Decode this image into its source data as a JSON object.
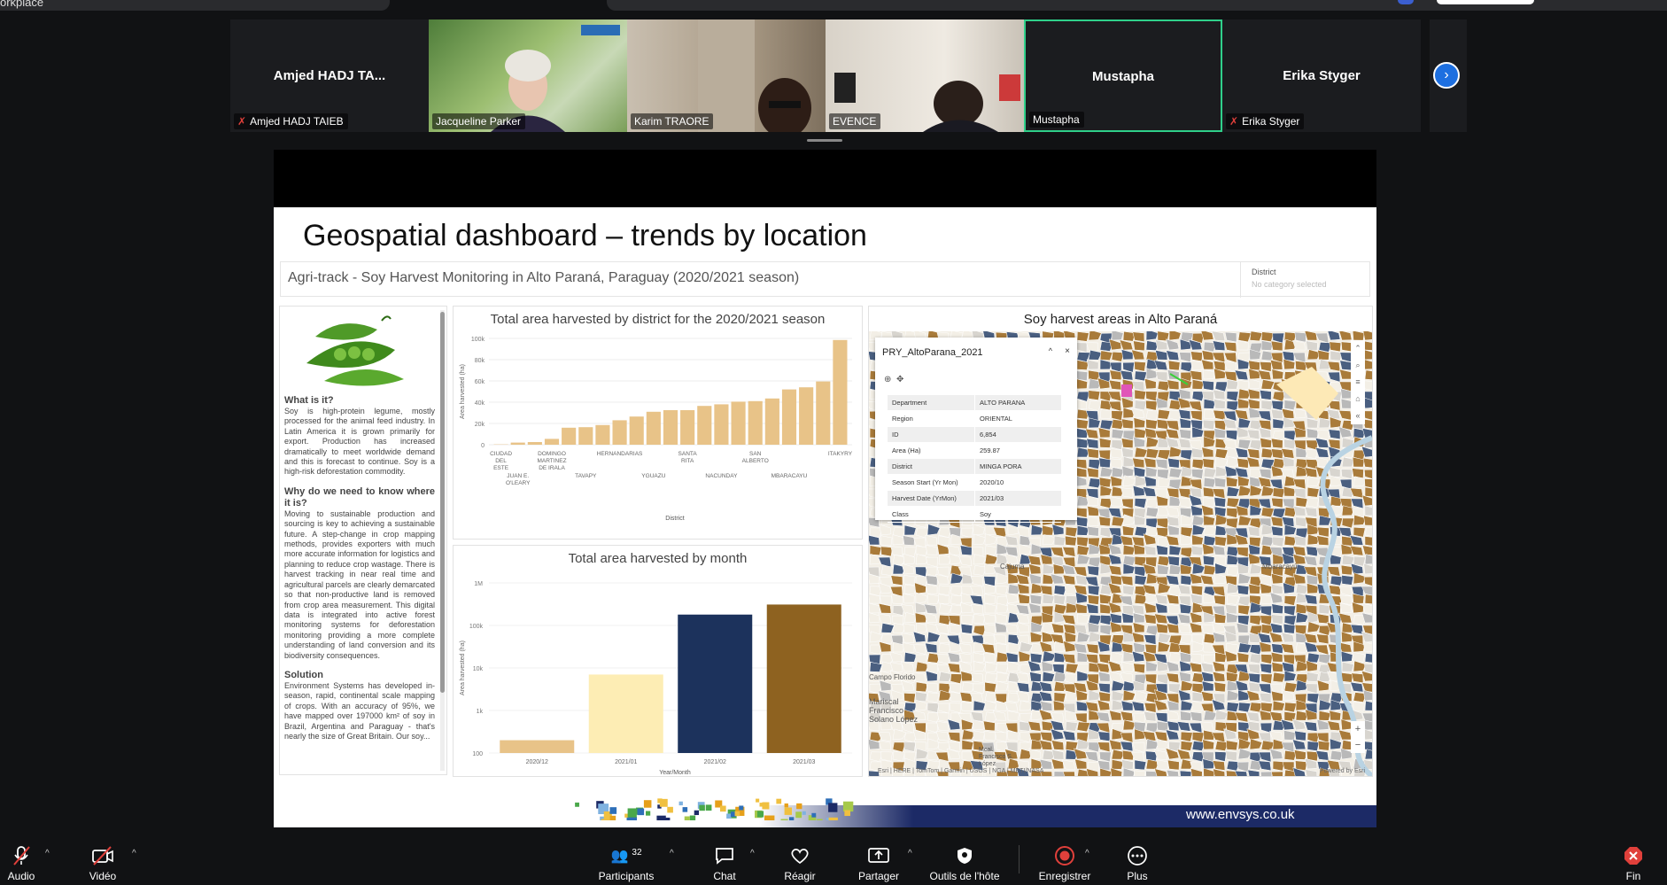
{
  "window": {
    "top_left_text": "orkplace"
  },
  "participants_strip": [
    {
      "display_name": "Amjed HADJ TA...",
      "tag": "Amjed HADJ TAIEB",
      "muted": true,
      "video": false
    },
    {
      "display_name": "",
      "tag": "Jacqueline Parker",
      "muted": false,
      "video": true
    },
    {
      "display_name": "",
      "tag": "Karim TRAORE",
      "muted": false,
      "video": true
    },
    {
      "display_name": "",
      "tag": "EVENCE",
      "muted": false,
      "video": true
    },
    {
      "display_name": "Mustapha",
      "tag": "Mustapha",
      "muted": false,
      "video": false,
      "active": true
    },
    {
      "display_name": "Erika Styger",
      "tag": "Erika Styger",
      "muted": true,
      "video": false
    }
  ],
  "slide": {
    "title": "Geospatial dashboard – trends by location",
    "dashboard_title": "Agri-track - Soy Harvest Monitoring in Alto Paraná, Paraguay (2020/2021 season)",
    "district_filter": {
      "label": "District",
      "value": "No category selected"
    },
    "info": {
      "h1": "What is it?",
      "p1": "Soy is high-protein legume, mostly processed for the animal feed industry. In Latin America it is grown primarily for export. Production has increased dramatically to meet worldwide demand and this is forecast to continue. Soy is a high-risk deforestation commodity.",
      "h2": "Why do we need to know where it is?",
      "p2": "Moving to sustainable production and sourcing is key to achieving a sustainable future. A step-change in crop mapping methods, provides exporters with much more accurate information for logistics and planning to reduce crop wastage. There is harvest tracking in near real time and agricultural parcels are clearly demarcated so that non-productive land is removed from crop area measurement. This digital data is integrated into active forest monitoring systems for deforestation monitoring providing a more complete understanding of land conversion and its biodiversity consequences.",
      "h3": "Solution",
      "p3": "Environment Systems has developed in-season, rapid, continental scale mapping of crops. With an accuracy of 95%, we have mapped over 197000 km² of soy in Brazil, Argentina and Paraguay - that's nearly the size of Great Britain. Our soy..."
    },
    "map": {
      "title": "Soy harvest areas in Alto Paraná",
      "popup": {
        "title": "PRY_AltoParana_2021",
        "rows": [
          [
            "Department",
            "ALTO PARANA"
          ],
          [
            "Region",
            "ORIENTAL"
          ],
          [
            "ID",
            "6,854"
          ],
          [
            "Area (Ha)",
            "259.87"
          ],
          [
            "District",
            "MINGA PORA"
          ],
          [
            "Season Start (Yr Mon)",
            "2020/10"
          ],
          [
            "Harvest Date (YrMon)",
            "2021/03"
          ],
          [
            "Class",
            "Soy"
          ]
        ]
      },
      "labels": [
        "Mbaracayú",
        "Cajuma",
        "Mariscal Francisco Solano López",
        "Mcal. Francisco S. López",
        "Campo Florido"
      ],
      "attribution": "Esri | HERE | TomTom | Garmin | USGS | NGA | METI/NASA",
      "powered": "Powered by Esri"
    },
    "footer_url": "www.envsys.co.uk"
  },
  "chart_data": [
    {
      "type": "bar",
      "title": "Total area harvested by district for the 2020/2021 season",
      "xlabel": "District",
      "ylabel": "Area harvested (ha)",
      "ylim": [
        0,
        100000
      ],
      "yticks": [
        "0",
        "20k",
        "40k",
        "60k",
        "80k",
        "100k"
      ],
      "categories": [
        "CIUDAD DEL ESTE",
        "JUAN E. O'LEARY",
        "",
        "DOMINGO MARTINEZ DE IRALA",
        "",
        "TAVAPY",
        "",
        "HERNANDARIAS",
        "",
        "YGUAZU",
        "",
        "SANTA RITA",
        "",
        "NACUNDAY",
        "",
        "SAN ALBERTO",
        "",
        "MBARACAYU",
        "",
        "",
        "ITAKYRY"
      ],
      "tick_labels_top": [
        "CIUDAD DEL ESTE",
        "DOMINGO MARTINEZ DE IRALA",
        "HERNANDARIAS",
        "SANTA RITA",
        "SAN ALBERTO",
        "ITAKYRY"
      ],
      "tick_labels_bottom": [
        "JUAN E. O'LEARY",
        "TAVAPY",
        "YGUAZU",
        "NACUNDAY",
        "MBARACAYU"
      ],
      "values": [
        300,
        2000,
        2500,
        5500,
        16000,
        16500,
        18500,
        23000,
        26500,
        31000,
        32500,
        32500,
        36500,
        38000,
        40500,
        41000,
        43500,
        52000,
        54000,
        59500,
        98500
      ],
      "color": "#e8c388"
    },
    {
      "type": "bar",
      "title": "Total area harvested by month",
      "xlabel": "Year/Month",
      "ylabel": "Area harvested (ha)",
      "yscale": "log",
      "yticks": [
        "100",
        "1k",
        "10k",
        "100k",
        "1M"
      ],
      "categories": [
        "2020/12",
        "2021/01",
        "2021/02",
        "2021/03"
      ],
      "values": [
        200,
        7000,
        180000,
        310000
      ],
      "colors": [
        "#e8c388",
        "#fdedb4",
        "#1c325c",
        "#8e6220"
      ]
    }
  ],
  "toolbar": {
    "audio": "Audio",
    "video": "Vidéo",
    "participants": "Participants",
    "participants_count": "32",
    "chat": "Chat",
    "react": "Réagir",
    "share": "Partager",
    "host_tools": "Outils de l'hôte",
    "record": "Enregistrer",
    "more": "Plus",
    "end": "Fin"
  }
}
